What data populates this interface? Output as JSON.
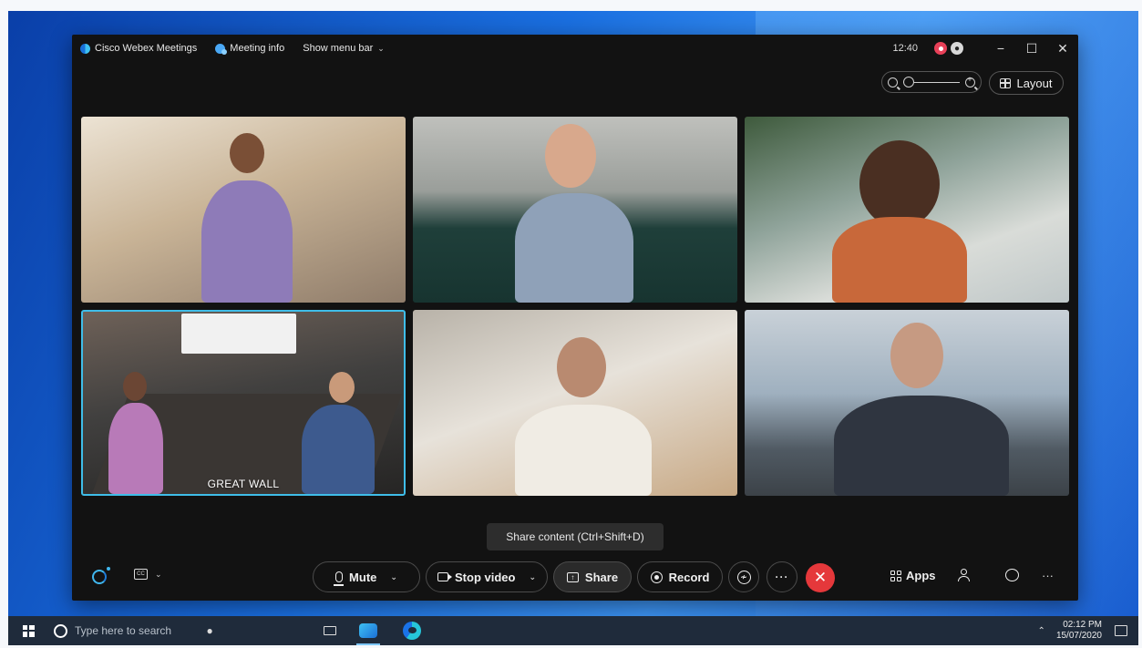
{
  "app": {
    "name": "Cisco Webex Meetings",
    "meeting_info": "Meeting info",
    "show_menu_bar": "Show menu bar",
    "time": "12:40"
  },
  "window_controls": {
    "minimize": "−",
    "maximize": "☐",
    "close": "✕"
  },
  "view": {
    "layout_label": "Layout"
  },
  "tiles": [
    {
      "label": ""
    },
    {
      "label": ""
    },
    {
      "label": ""
    },
    {
      "label": "GREAT WALL",
      "active_speaker": true
    },
    {
      "label": ""
    },
    {
      "label": ""
    }
  ],
  "tooltip": {
    "share_content": "Share content (Ctrl+Shift+D)"
  },
  "controls": {
    "mute_label": "Mute",
    "stop_video_label": "Stop video",
    "share_label": "Share",
    "record_label": "Record",
    "more_glyph": "···",
    "leave_glyph": "✕",
    "apps_label": "Apps",
    "more_options_glyph": "···"
  },
  "taskbar": {
    "search_placeholder": "Type here to search",
    "clock_time": "02:12 PM",
    "clock_date": "15/07/2020"
  },
  "colors": {
    "accent": "#3fbde8",
    "leave": "#e5383b",
    "record_indicator": "#e84058"
  }
}
